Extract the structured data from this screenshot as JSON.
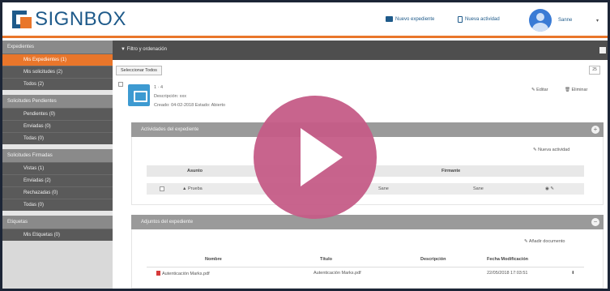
{
  "app": {
    "logo_text": "SIGNBOX"
  },
  "header": {
    "new_record_label": "Nuevo expediente",
    "new_activity_label": "Nueva actividad",
    "user_name": "Sanne",
    "user_menu_caret": "▾"
  },
  "sidebar": {
    "sections": [
      {
        "title": "Expedientes",
        "items": [
          "Mis Expedientes (1)",
          "Mis solicitudes (2)",
          "Todos (2)"
        ]
      },
      {
        "title": "Solicitudes Pendientes",
        "items": [
          "Pendientes (0)",
          "Enviadas (0)",
          "Todas (0)"
        ]
      },
      {
        "title": "Solicitudes Firmadas",
        "items": [
          "Vistas (1)",
          "Enviadas (2)",
          "Rechazadas (0)",
          "Todas (0)"
        ]
      },
      {
        "title": "Etiquetas",
        "items": [
          "Mis Etiquetas (0)"
        ]
      }
    ],
    "active_item": "Mis Expedientes (1)"
  },
  "main": {
    "filter_title": "▼ Filtro y ordenación",
    "select_all_label": "Seleccionar Todos",
    "mini_button_label": "25",
    "record": {
      "title": "1 · 4",
      "line2": "Descripción: xxx",
      "line3": "Creado: 04-02-2018 Estado: Abierto",
      "edit_label": "✎ Editar",
      "delete_label": "🗑 Eliminar"
    },
    "activities_panel": {
      "title": "Actividades del expediente",
      "toggle": "+",
      "new_activity_link": "✎ Nueva actividad",
      "columns": [
        "Asunto",
        "Firmante"
      ],
      "rows": [
        {
          "subject": "▲ Prueba",
          "col3": "Sane",
          "signer": "Sane"
        }
      ]
    },
    "documents_panel": {
      "title": "Adjuntos del expediente",
      "toggle": "−",
      "add_doc_link": "✎ Añadir documento",
      "columns": [
        "Nombre",
        "Título",
        "Descripción",
        "Fecha Modificación"
      ],
      "rows": [
        {
          "name": "Autenticación Marks.pdf",
          "title": "Autenticación Marks.pdf",
          "description": "",
          "modified": "22/05/2018 17:03:51"
        }
      ]
    }
  },
  "colors": {
    "accent": "#e9762b",
    "brand": "#1e5a8a",
    "play": "#c55c87"
  }
}
